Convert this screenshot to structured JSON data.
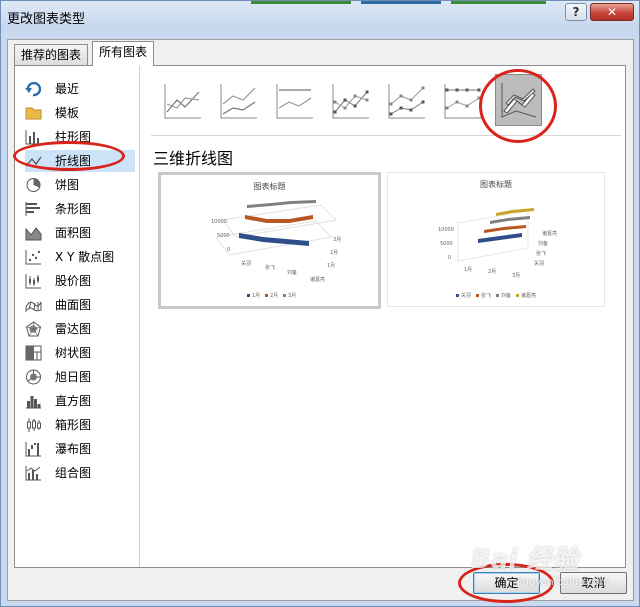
{
  "window": {
    "title": "更改图表类型",
    "help_label": "?",
    "close_label": "✕"
  },
  "tabs": [
    {
      "label": "推荐的图表",
      "active": false
    },
    {
      "label": "所有图表",
      "active": true
    }
  ],
  "sidebar": {
    "items": [
      {
        "label": "最近",
        "icon": "recent-icon"
      },
      {
        "label": "模板",
        "icon": "folder-icon"
      },
      {
        "label": "柱形图",
        "icon": "column-chart-icon"
      },
      {
        "label": "折线图",
        "icon": "line-chart-icon",
        "selected": true
      },
      {
        "label": "饼图",
        "icon": "pie-chart-icon"
      },
      {
        "label": "条形图",
        "icon": "bar-chart-icon"
      },
      {
        "label": "面积图",
        "icon": "area-chart-icon"
      },
      {
        "label": "X Y 散点图",
        "icon": "scatter-chart-icon"
      },
      {
        "label": "股价图",
        "icon": "stock-chart-icon"
      },
      {
        "label": "曲面图",
        "icon": "surface-chart-icon"
      },
      {
        "label": "雷达图",
        "icon": "radar-chart-icon"
      },
      {
        "label": "树状图",
        "icon": "treemap-chart-icon"
      },
      {
        "label": "旭日图",
        "icon": "sunburst-chart-icon"
      },
      {
        "label": "直方图",
        "icon": "histogram-chart-icon"
      },
      {
        "label": "箱形图",
        "icon": "box-whisker-chart-icon"
      },
      {
        "label": "瀑布图",
        "icon": "waterfall-chart-icon"
      },
      {
        "label": "组合图",
        "icon": "combo-chart-icon"
      }
    ]
  },
  "subtypes": {
    "selected_index": 6,
    "items": [
      {
        "icon": "line-subtype-icon"
      },
      {
        "icon": "stacked-line-subtype-icon"
      },
      {
        "icon": "percent-stacked-line-subtype-icon"
      },
      {
        "icon": "line-markers-subtype-icon"
      },
      {
        "icon": "stacked-line-markers-subtype-icon"
      },
      {
        "icon": "percent-stacked-line-markers-subtype-icon"
      },
      {
        "icon": "3d-line-subtype-icon"
      }
    ]
  },
  "subtype_title": "三维折线图",
  "previews": [
    {
      "title": "图表标题",
      "axis_values": [
        "10000",
        "5000",
        "0"
      ],
      "categories": [
        "关羽",
        "张飞",
        "刘备",
        "诸葛亮"
      ],
      "depth_labels": [
        "3月",
        "2月",
        "1月"
      ],
      "legend": [
        "1月",
        "2月",
        "3月"
      ],
      "series_colors": [
        "#2e4d8a",
        "#b8561f",
        "#808080"
      ],
      "selected": true
    },
    {
      "title": "图表标题",
      "axis_values": [
        "10000",
        "5000",
        "0"
      ],
      "categories": [
        "1月",
        "2月",
        "3月"
      ],
      "depth_labels": [
        "诸葛亮",
        "刘备",
        "张飞",
        "关羽"
      ],
      "legend": [
        "关羽",
        "张飞",
        "刘备",
        "诸葛亮"
      ],
      "series_colors": [
        "#2e4d8a",
        "#b8561f",
        "#808080",
        "#c9a227"
      ],
      "selected": false
    }
  ],
  "buttons": {
    "ok": "确定",
    "cancel": "取消"
  },
  "watermark": {
    "text": "Bai 经验",
    "sub": "jingyan.baidu.com"
  },
  "colors": {
    "highlight_ring": "#d9241c",
    "selection": "#cde3f7"
  }
}
